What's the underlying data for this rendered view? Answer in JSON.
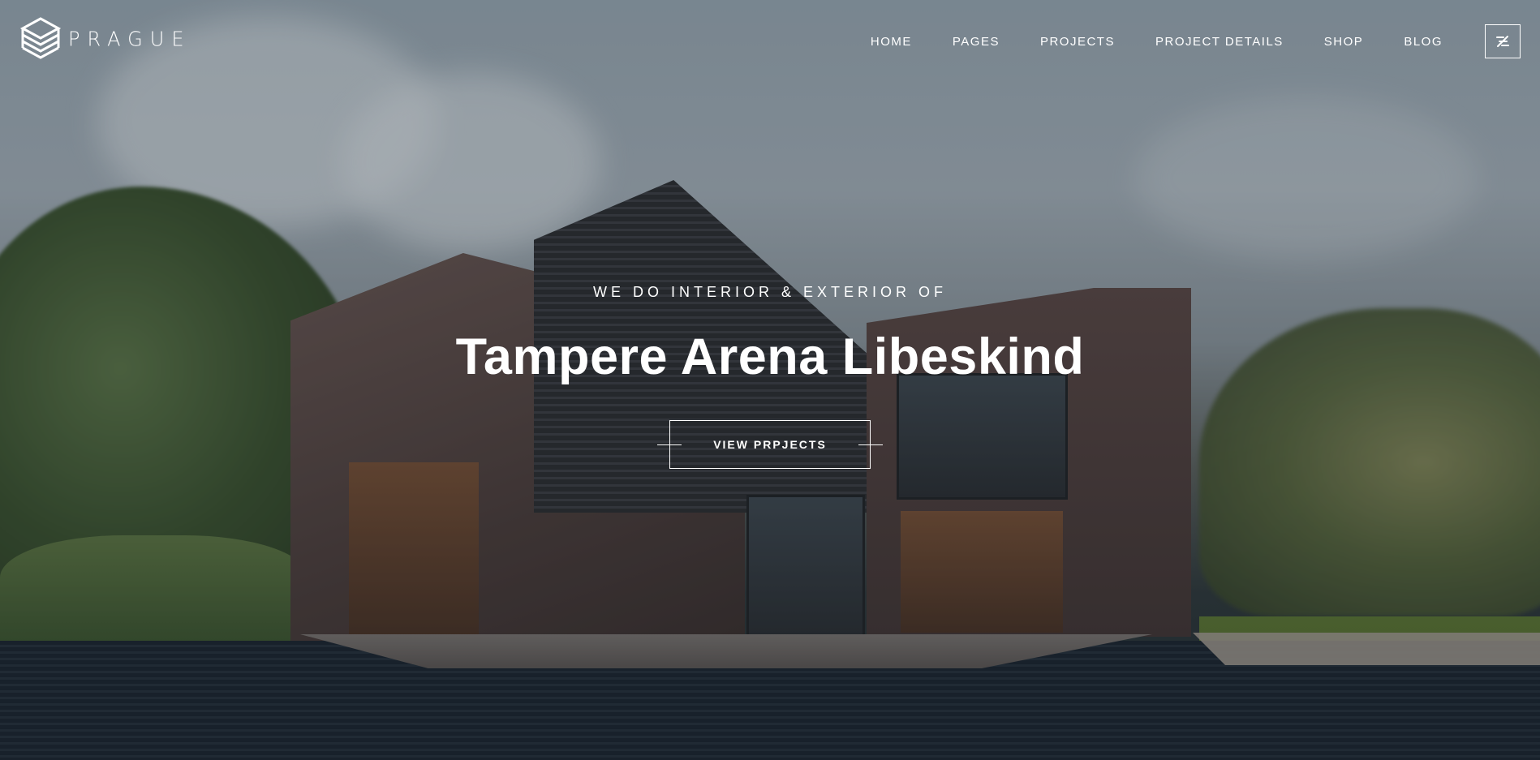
{
  "brand": {
    "name": "PRAGUE",
    "logo_icon": "stacked-diamond-logo-icon"
  },
  "nav": {
    "items": [
      {
        "label": "HOME"
      },
      {
        "label": "PAGES"
      },
      {
        "label": "PROJECTS"
      },
      {
        "label": "PROJECT DETAILS"
      },
      {
        "label": "SHOP"
      },
      {
        "label": "BLOG"
      }
    ],
    "toggle_icon": "menu-toggle-icon"
  },
  "hero": {
    "eyebrow": "WE DO INTERIOR & EXTERIOR OF",
    "title": "Tampere Arena Libeskind",
    "cta_label": "VIEW PRPJECTS"
  },
  "colors": {
    "text": "#ffffff",
    "overlay": "rgba(20,26,32,0.28)"
  }
}
